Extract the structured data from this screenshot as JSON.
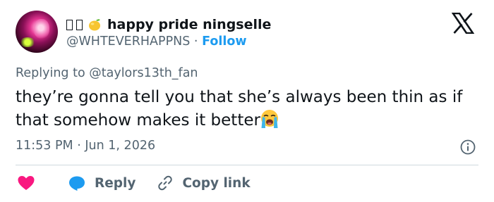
{
  "author": {
    "display_name": "happy pride ningselle",
    "name_prefix_glyphs": [
      "▯",
      "▯"
    ],
    "emoji_icon": "lemon-icon",
    "handle": "@WHTEVERHAPPNS",
    "separator": "·",
    "follow_label": "Follow"
  },
  "tweet": {
    "replying_prefix": "Replying to",
    "replying_to": "@taylors13th_fan",
    "text": "they’re gonna tell you that she’s always been thin as if that somehow makes it better",
    "trailing_emoji": "loudly-crying-face-icon",
    "time": "11:53 PM",
    "date_separator": "·",
    "date": "Jun 1, 2026"
  },
  "actions": {
    "reply_label": "Reply",
    "copy_link_label": "Copy link"
  },
  "colors": {
    "accent": "#1d9bf0",
    "like": "#f91880",
    "muted": "#536471",
    "text": "#0f1419",
    "divider": "#cfd9de"
  }
}
